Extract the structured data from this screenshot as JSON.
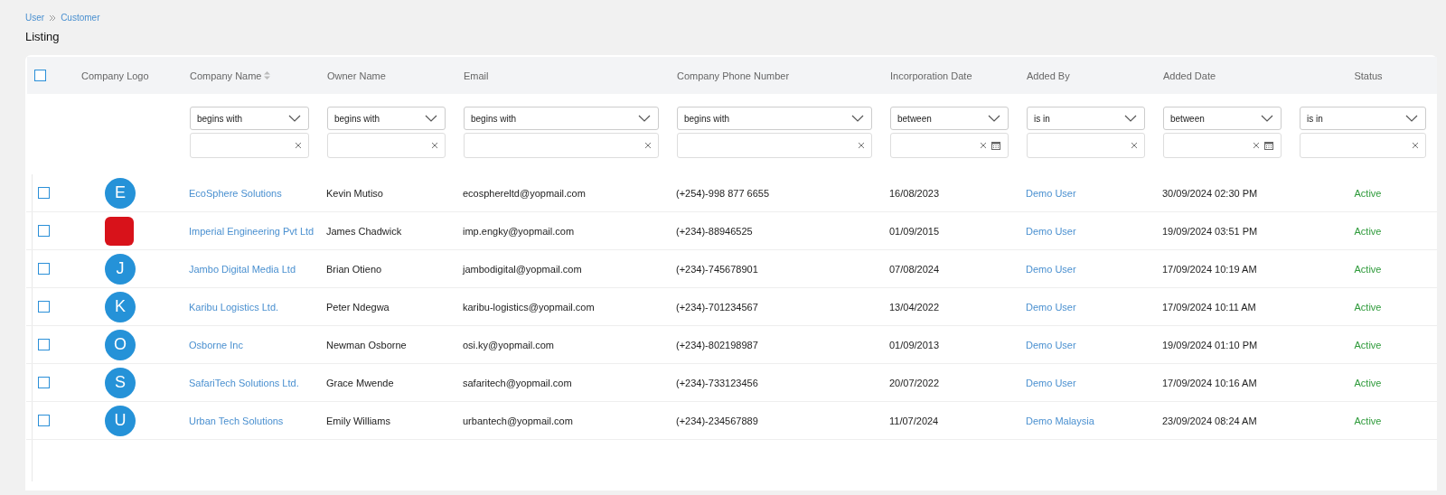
{
  "breadcrumb": [
    {
      "label": "User"
    },
    {
      "label": "Customer"
    }
  ],
  "page_title": "Listing",
  "table": {
    "select_all": {
      "checked": false
    },
    "columns": [
      {
        "label": "Company Logo"
      },
      {
        "label": "Company Name",
        "sortable": true,
        "filter": {
          "operator": "begins with",
          "kind": "text"
        }
      },
      {
        "label": "Owner Name",
        "filter": {
          "operator": "begins with",
          "kind": "text"
        }
      },
      {
        "label": "Email",
        "filter": {
          "operator": "begins with",
          "kind": "text"
        }
      },
      {
        "label": "Company Phone Number",
        "filter": {
          "operator": "begins with",
          "kind": "text"
        }
      },
      {
        "label": "Incorporation Date",
        "filter": {
          "operator": "between",
          "kind": "date"
        }
      },
      {
        "label": "Added By",
        "filter": {
          "operator": "is in",
          "kind": "text"
        }
      },
      {
        "label": "Added Date",
        "filter": {
          "operator": "between",
          "kind": "date"
        }
      },
      {
        "label": "Status",
        "filter": {
          "operator": "is in",
          "kind": "text"
        }
      }
    ],
    "rows": [
      {
        "checked": false,
        "logo": {
          "kind": "letter",
          "letter": "E"
        },
        "company_name": "EcoSphere Solutions",
        "owner_name": "Kevin Mutiso",
        "email": "ecosphereltd@yopmail.com",
        "phone": "(+254)-998 877 6655",
        "incorporation_date": "16/08/2023",
        "added_by": "Demo User",
        "added_date": "30/09/2024 02:30 PM",
        "status": "Active"
      },
      {
        "checked": false,
        "logo": {
          "kind": "image"
        },
        "company_name": "Imperial Engineering Pvt Ltd",
        "owner_name": "James Chadwick",
        "email": "imp.engky@yopmail.com",
        "phone": "(+234)-88946525",
        "incorporation_date": "01/09/2015",
        "added_by": "Demo User",
        "added_date": "19/09/2024 03:51 PM",
        "status": "Active"
      },
      {
        "checked": false,
        "logo": {
          "kind": "letter",
          "letter": "J"
        },
        "company_name": "Jambo Digital Media Ltd",
        "owner_name": "Brian Otieno",
        "email": "jambodigital@yopmail.com",
        "phone": "(+234)-745678901",
        "incorporation_date": "07/08/2024",
        "added_by": "Demo User",
        "added_date": "17/09/2024 10:19 AM",
        "status": "Active"
      },
      {
        "checked": false,
        "logo": {
          "kind": "letter",
          "letter": "K"
        },
        "company_name": "Karibu Logistics Ltd.",
        "owner_name": "Peter Ndegwa",
        "email": "karibu-logistics@yopmail.com",
        "phone": "(+234)-701234567",
        "incorporation_date": "13/04/2022",
        "added_by": "Demo User",
        "added_date": "17/09/2024 10:11 AM",
        "status": "Active"
      },
      {
        "checked": false,
        "logo": {
          "kind": "letter",
          "letter": "O"
        },
        "company_name": "Osborne Inc",
        "owner_name": "Newman Osborne",
        "email": "osi.ky@yopmail.com",
        "phone": "(+234)-802198987",
        "incorporation_date": "01/09/2013",
        "added_by": "Demo User",
        "added_date": "19/09/2024 01:10 PM",
        "status": "Active"
      },
      {
        "checked": false,
        "logo": {
          "kind": "letter",
          "letter": "S"
        },
        "company_name": "SafariTech Solutions Ltd.",
        "owner_name": "Grace Mwende",
        "email": "safaritech@yopmail.com",
        "phone": "(+234)-733123456",
        "incorporation_date": "20/07/2022",
        "added_by": "Demo User",
        "added_date": "17/09/2024 10:16 AM",
        "status": "Active"
      },
      {
        "checked": false,
        "logo": {
          "kind": "letter",
          "letter": "U"
        },
        "company_name": "Urban Tech Solutions",
        "owner_name": "Emily Williams",
        "email": "urbantech@yopmail.com",
        "phone": "(+234)-234567889",
        "incorporation_date": "11/07/2024",
        "added_by": "Demo Malaysia",
        "added_date": "23/09/2024 08:24 AM",
        "status": "Active"
      }
    ]
  }
}
